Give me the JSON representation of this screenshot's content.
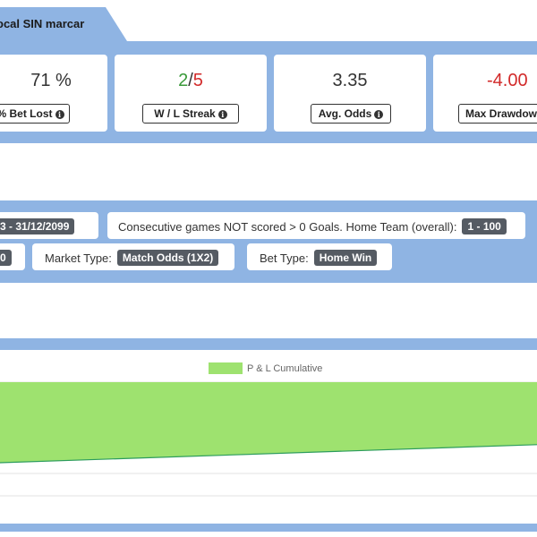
{
  "header": {
    "title": "ocal SIN marcar"
  },
  "stats": [
    {
      "value": "71 %",
      "label": "% Bet Lost"
    },
    {
      "value_win": "2",
      "value_sep": "/",
      "value_loss": "5",
      "label": "W / L Streak"
    },
    {
      "value": "3.35",
      "label": "Avg. Odds"
    },
    {
      "value": "-4.00",
      "label": "Max Drawdow"
    }
  ],
  "icons": {
    "info": "info-circle-icon"
  },
  "colors": {
    "band": "#8fb4e3",
    "win": "#3a9a3a",
    "loss": "#d22a2a",
    "chip": "#555b63",
    "area": "#9ee26f"
  },
  "filters": {
    "date_range": "3 - 31/12/2099",
    "consecutive_label": "Consecutive games NOT scored > 0 Goals. Home Team (overall):",
    "consecutive_value": "1 - 100",
    "left_chip": "0",
    "market_label": "Market Type:",
    "market_value": "Match Odds (1X2)",
    "bet_label": "Bet Type:",
    "bet_value": "Home Win"
  },
  "chart_data": {
    "type": "area",
    "series": [
      {
        "name": "P & L Cumulative",
        "values": [
          -4.0,
          -3.1
        ]
      }
    ],
    "legend_position": "top-center",
    "grid": true
  }
}
